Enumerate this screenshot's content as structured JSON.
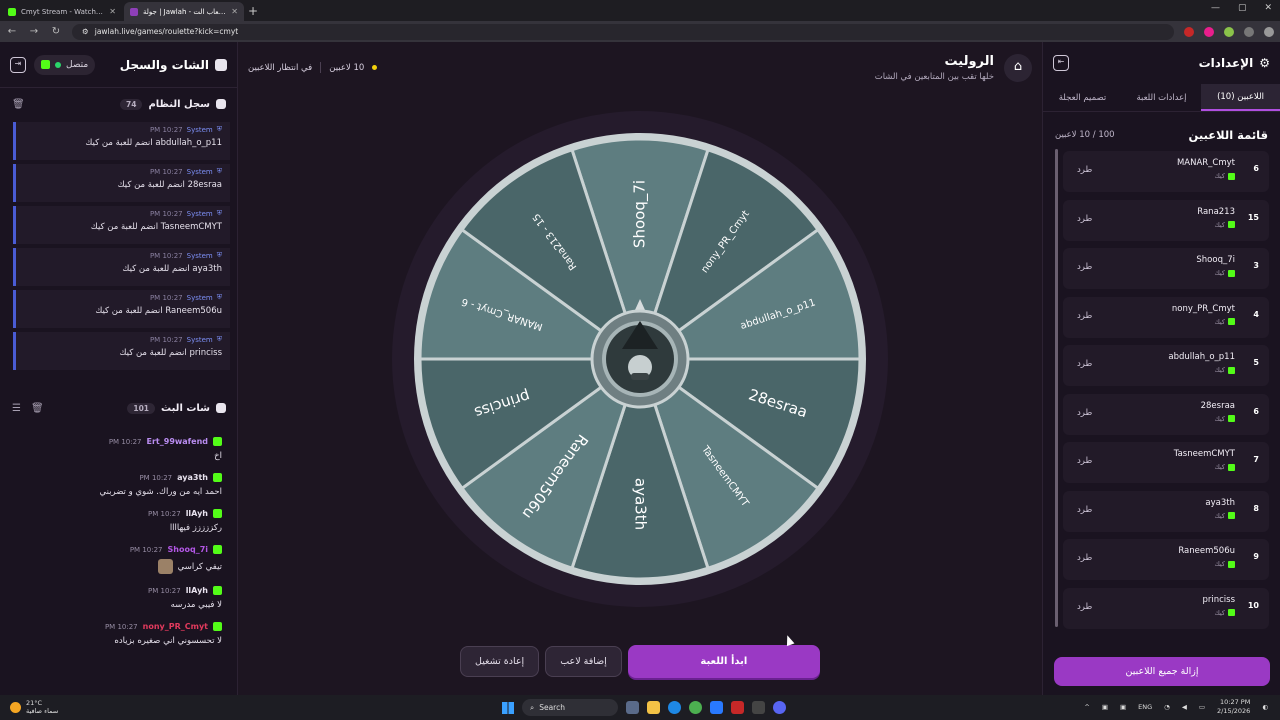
{
  "browser": {
    "tabs": [
      {
        "title": "Cmyt Stream - Watch Live on K",
        "active": false
      },
      {
        "title": "جولة | Jawlah - منصة الألعاب الت",
        "active": true
      }
    ],
    "url": "jawlah.live/games/roulette?kick=cmyt"
  },
  "chat_panel": {
    "title": "الشات والسجل",
    "status": "متصل",
    "system_log": {
      "title": "سجل النظام",
      "count": "74",
      "entries": [
        {
          "sender": "System",
          "time": "10:27 PM",
          "text": "abdullah_o_p11 انضم للعبة من كيك"
        },
        {
          "sender": "System",
          "time": "10:27 PM",
          "text": "28esraa انضم للعبة من كيك"
        },
        {
          "sender": "System",
          "time": "10:27 PM",
          "text": "TasneemCMYT انضم للعبة من كيك"
        },
        {
          "sender": "System",
          "time": "10:27 PM",
          "text": "aya3th انضم للعبة من كيك"
        },
        {
          "sender": "System",
          "time": "10:27 PM",
          "text": "Raneem506u انضم للعبة من كيك"
        },
        {
          "sender": "System",
          "time": "10:27 PM",
          "text": "princiss انضم للعبة من كيك"
        }
      ]
    },
    "live_chat": {
      "title": "شات البث",
      "count": "101",
      "messages": [
        {
          "user": "Ert_99wafend",
          "time": "10:27 PM",
          "text": "اخ",
          "color": "#b98cf0"
        },
        {
          "user": "aya3th",
          "time": "10:27 PM",
          "text": "احمد ايه من وراك. شوي و تضربني",
          "color": "#e9e3ef"
        },
        {
          "user": "llAyh",
          "time": "10:27 PM",
          "text": "ركززززز فيهاااا",
          "color": "#e9e3ef"
        },
        {
          "user": "Shooq_7i",
          "time": "10:27 PM",
          "text": "تيفي كراسي",
          "color": "#b357e6"
        },
        {
          "user": "llAyh",
          "time": "10:27 PM",
          "text": "لا فيبي مدرسه",
          "color": "#e9e3ef"
        },
        {
          "user": "nony_PR_Cmyt",
          "time": "10:27 PM",
          "text": "لا تحسسوني اني صغيره بزياده",
          "color": "#e23a5d"
        }
      ]
    }
  },
  "game": {
    "title": "الروليت",
    "subtitle": "خلها تقب بين المتابعين في الشات",
    "players_count": "10 لاعبين",
    "waiting": "في انتظار اللاعبين",
    "wheel_segments": [
      "Shooq_7i",
      "nony_PR_Cmyt",
      "abdullah_o_p11",
      "28esraa",
      "TasneemCMYT",
      "aya3th",
      "Raneem506u",
      "princiss",
      "MANAR_Cmyt - 6",
      "Rana213 - 15"
    ],
    "buttons": {
      "restart": "إعادة تشغيل",
      "add_player": "إضافة لاعب",
      "start": "ابدأ اللعبة"
    },
    "colors": {
      "accent": "#9a39c4",
      "wheel_a": "#4a6669",
      "wheel_b": "#5e7d80"
    }
  },
  "settings": {
    "title": "الإعدادات",
    "tabs": [
      "اللاعبين (10)",
      "إعدادات اللعبة",
      "تصميم العجلة"
    ],
    "players_list_title": "قائمة اللاعبين",
    "players_capacity": "100 / 10 لاعبين",
    "kick_label": "طرد",
    "platform_label": "كيك",
    "players": [
      {
        "rank": "6",
        "name": "MANAR_Cmyt"
      },
      {
        "rank": "15",
        "name": "Rana213"
      },
      {
        "rank": "3",
        "name": "Shooq_7i"
      },
      {
        "rank": "4",
        "name": "nony_PR_Cmyt"
      },
      {
        "rank": "5",
        "name": "abdullah_o_p11"
      },
      {
        "rank": "6",
        "name": "28esraa"
      },
      {
        "rank": "7",
        "name": "TasneemCMYT"
      },
      {
        "rank": "8",
        "name": "aya3th"
      },
      {
        "rank": "9",
        "name": "Raneem506u"
      },
      {
        "rank": "10",
        "name": "princiss"
      }
    ],
    "remove_all": "إزالة جميع اللاعبين"
  },
  "taskbar": {
    "weather_temp": "21°C",
    "weather_text": "سماء صافية",
    "search": "Search",
    "lang": "ENG",
    "time": "10:27 PM",
    "date": "2/15/2026"
  }
}
